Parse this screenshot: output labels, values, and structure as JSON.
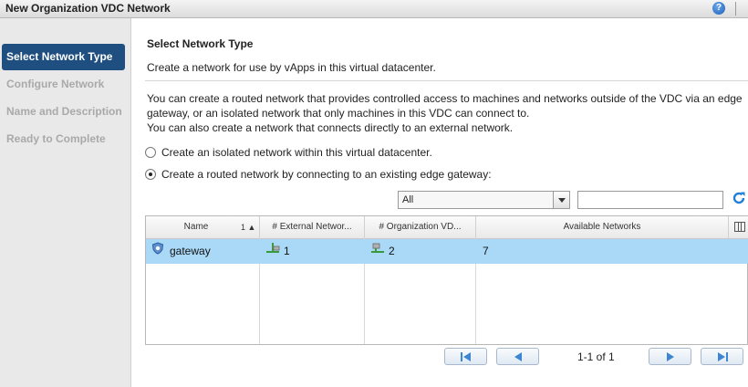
{
  "window": {
    "title": "New Organization VDC Network",
    "help_label": "?"
  },
  "sidebar": {
    "steps": [
      {
        "label": "Select Network Type",
        "active": true
      },
      {
        "label": "Configure Network",
        "active": false
      },
      {
        "label": "Name and Description",
        "active": false
      },
      {
        "label": "Ready to Complete",
        "active": false
      }
    ]
  },
  "main": {
    "heading": "Select Network Type",
    "subheading": "Create a network for use by vApps in this virtual datacenter.",
    "description": [
      "You can create a routed network that provides controlled access to machines and networks outside of the VDC via an edge",
      "gateway, or an isolated network that only machines in this VDC can connect to.",
      "You can also create a network that connects directly to an external network."
    ],
    "options": [
      {
        "label": "Create an isolated network within this virtual datacenter.",
        "checked": false
      },
      {
        "label": "Create a routed network by connecting to an existing edge gateway:",
        "checked": true
      }
    ]
  },
  "filter": {
    "select_value": "All",
    "search_value": ""
  },
  "table": {
    "columns": [
      "Name",
      "# External Networ...",
      "# Organization VD...",
      "Available Networks"
    ],
    "sort_indicator": "1 ▲",
    "rows": [
      {
        "name": "gateway",
        "external_networks": "1",
        "org_vdc_networks": "2",
        "available_networks": "7"
      }
    ]
  },
  "pager": {
    "text": "1-1 of 1"
  },
  "colors": {
    "accent": "#1f4f80",
    "selected_row": "#a9d9f7",
    "refresh": "#1f7fd6"
  },
  "icons": [
    "help-icon",
    "refresh-icon",
    "gateway-icon",
    "external-network-icon",
    "org-network-icon",
    "column-chooser-icon",
    "first-page-icon",
    "prev-page-icon",
    "next-page-icon",
    "last-page-icon"
  ]
}
